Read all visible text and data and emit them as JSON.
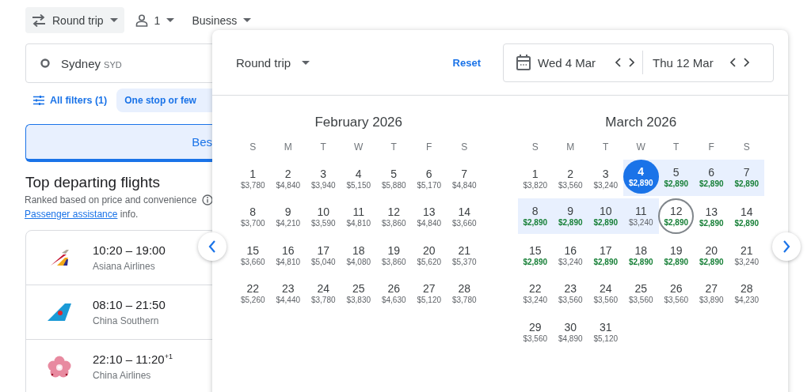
{
  "top_bar": {
    "trip_type": "Round trip",
    "passengers": "1",
    "cabin": "Business"
  },
  "origin": {
    "city": "Sydney",
    "code": "SYD"
  },
  "filters": [
    {
      "kind": "button",
      "label": "All filters (1)"
    },
    {
      "kind": "chip",
      "label": "One stop or few"
    }
  ],
  "sort_tabs": [
    {
      "label": "Bes",
      "selected": true
    }
  ],
  "section": {
    "title": "Top departing flights",
    "subtitle": "Ranked based on price and convenience",
    "link": "Passenger assistance",
    "link_suffix": " info."
  },
  "flights": [
    {
      "kind": "stripes",
      "times": "10:20 – 19:00",
      "airline": "Asiana Airlines"
    },
    {
      "kind": "tail",
      "times": "08:10 – 21:50",
      "airline": "China Southern"
    },
    {
      "kind": "flower",
      "times": "22:10 – 11:20$^{+1}$",
      "airline": "China Airlines"
    }
  ],
  "date_picker": {
    "trip_type": "Round trip",
    "reset": "Reset",
    "departure": "Wed 4 Mar",
    "return": "Thu 12 Mar",
    "months": [
      {
        "title": "February 2026",
        "weekdays": [
          "S",
          "M",
          "T",
          "W",
          "T",
          "F",
          "S"
        ],
        "days": [
          {
            "day": "1",
            "price": "$3,780",
            "low": false,
            "kind": "plain"
          },
          {
            "day": "2",
            "price": "$4,840",
            "low": false,
            "kind": "plain"
          },
          {
            "day": "3",
            "price": "$3,940",
            "low": false,
            "kind": "plain"
          },
          {
            "day": "4",
            "price": "$5,150",
            "low": false,
            "kind": "plain"
          },
          {
            "day": "5",
            "price": "$5,880",
            "low": false,
            "kind": "plain"
          },
          {
            "day": "6",
            "price": "$5,170",
            "low": false,
            "kind": "plain"
          },
          {
            "day": "7",
            "price": "$4,840",
            "low": false,
            "kind": "plain"
          },
          {
            "day": "8",
            "price": "$3,700",
            "low": false,
            "kind": "plain"
          },
          {
            "day": "9",
            "price": "$4,210",
            "low": false,
            "kind": "plain"
          },
          {
            "day": "10",
            "price": "$3,590",
            "low": false,
            "kind": "plain"
          },
          {
            "day": "11",
            "price": "$4,810",
            "low": false,
            "kind": "plain"
          },
          {
            "day": "12",
            "price": "$3,860",
            "low": false,
            "kind": "plain"
          },
          {
            "day": "13",
            "price": "$4,840",
            "low": false,
            "kind": "plain"
          },
          {
            "day": "14",
            "price": "$3,660",
            "low": false,
            "kind": "plain"
          },
          {
            "day": "15",
            "price": "$3,660",
            "low": false,
            "kind": "plain"
          },
          {
            "day": "16",
            "price": "$4,810",
            "low": false,
            "kind": "plain"
          },
          {
            "day": "17",
            "price": "$5,040",
            "low": false,
            "kind": "plain"
          },
          {
            "day": "18",
            "price": "$4,080",
            "low": false,
            "kind": "plain"
          },
          {
            "day": "19",
            "price": "$3,860",
            "low": false,
            "kind": "plain"
          },
          {
            "day": "20",
            "price": "$5,620",
            "low": false,
            "kind": "plain"
          },
          {
            "day": "21",
            "price": "$5,370",
            "low": false,
            "kind": "plain"
          },
          {
            "day": "22",
            "price": "$5,260",
            "low": false,
            "kind": "plain"
          },
          {
            "day": "23",
            "price": "$4,440",
            "low": false,
            "kind": "plain"
          },
          {
            "day": "24",
            "price": "$3,780",
            "low": false,
            "kind": "plain"
          },
          {
            "day": "25",
            "price": "$3,830",
            "low": false,
            "kind": "plain"
          },
          {
            "day": "26",
            "price": "$4,630",
            "low": false,
            "kind": "plain"
          },
          {
            "day": "27",
            "price": "$5,120",
            "low": false,
            "kind": "plain"
          },
          {
            "day": "28",
            "price": "$3,780",
            "low": false,
            "kind": "plain"
          }
        ]
      },
      {
        "title": "March 2026",
        "weekdays": [
          "S",
          "M",
          "T",
          "W",
          "T",
          "F",
          "S"
        ],
        "days": [
          {
            "day": "1",
            "price": "$3,820",
            "low": false,
            "kind": "plain"
          },
          {
            "day": "2",
            "price": "$3,560",
            "low": false,
            "kind": "plain"
          },
          {
            "day": "3",
            "price": "$3,240",
            "low": false,
            "kind": "plain"
          },
          {
            "day": "4",
            "price": "$2,890",
            "low": true,
            "kind": "start"
          },
          {
            "day": "5",
            "price": "$2,890",
            "low": true,
            "kind": "between"
          },
          {
            "day": "6",
            "price": "$2,890",
            "low": true,
            "kind": "between"
          },
          {
            "day": "7",
            "price": "$2,890",
            "low": true,
            "kind": "between"
          },
          {
            "day": "8",
            "price": "$2,890",
            "low": true,
            "kind": "between"
          },
          {
            "day": "9",
            "price": "$2,890",
            "low": true,
            "kind": "between"
          },
          {
            "day": "10",
            "price": "$2,890",
            "low": true,
            "kind": "between"
          },
          {
            "day": "11",
            "price": "$3,240",
            "low": false,
            "kind": "between"
          },
          {
            "day": "12",
            "price": "$2,890",
            "low": true,
            "kind": "end"
          },
          {
            "day": "13",
            "price": "$2,890",
            "low": true,
            "kind": "plain"
          },
          {
            "day": "14",
            "price": "$2,890",
            "low": true,
            "kind": "plain"
          },
          {
            "day": "15",
            "price": "$2,890",
            "low": true,
            "kind": "plain"
          },
          {
            "day": "16",
            "price": "$3,240",
            "low": false,
            "kind": "plain"
          },
          {
            "day": "17",
            "price": "$2,890",
            "low": true,
            "kind": "plain"
          },
          {
            "day": "18",
            "price": "$2,890",
            "low": true,
            "kind": "plain"
          },
          {
            "day": "19",
            "price": "$2,890",
            "low": true,
            "kind": "plain"
          },
          {
            "day": "20",
            "price": "$2,890",
            "low": true,
            "kind": "plain"
          },
          {
            "day": "21",
            "price": "$3,240",
            "low": false,
            "kind": "plain"
          },
          {
            "day": "22",
            "price": "$3,240",
            "low": false,
            "kind": "plain"
          },
          {
            "day": "23",
            "price": "$3,560",
            "low": false,
            "kind": "plain"
          },
          {
            "day": "24",
            "price": "$3,560",
            "low": false,
            "kind": "plain"
          },
          {
            "day": "25",
            "price": "$3,560",
            "low": false,
            "kind": "plain"
          },
          {
            "day": "26",
            "price": "$3,560",
            "low": false,
            "kind": "plain"
          },
          {
            "day": "27",
            "price": "$3,890",
            "low": false,
            "kind": "plain"
          },
          {
            "day": "28",
            "price": "$4,230",
            "low": false,
            "kind": "plain"
          },
          {
            "day": "29",
            "price": "$3,560",
            "low": false,
            "kind": "plain"
          },
          {
            "day": "30",
            "price": "$4,890",
            "low": false,
            "kind": "plain"
          },
          {
            "day": "31",
            "price": "$5,120",
            "low": false,
            "kind": "plain"
          }
        ]
      }
    ]
  }
}
